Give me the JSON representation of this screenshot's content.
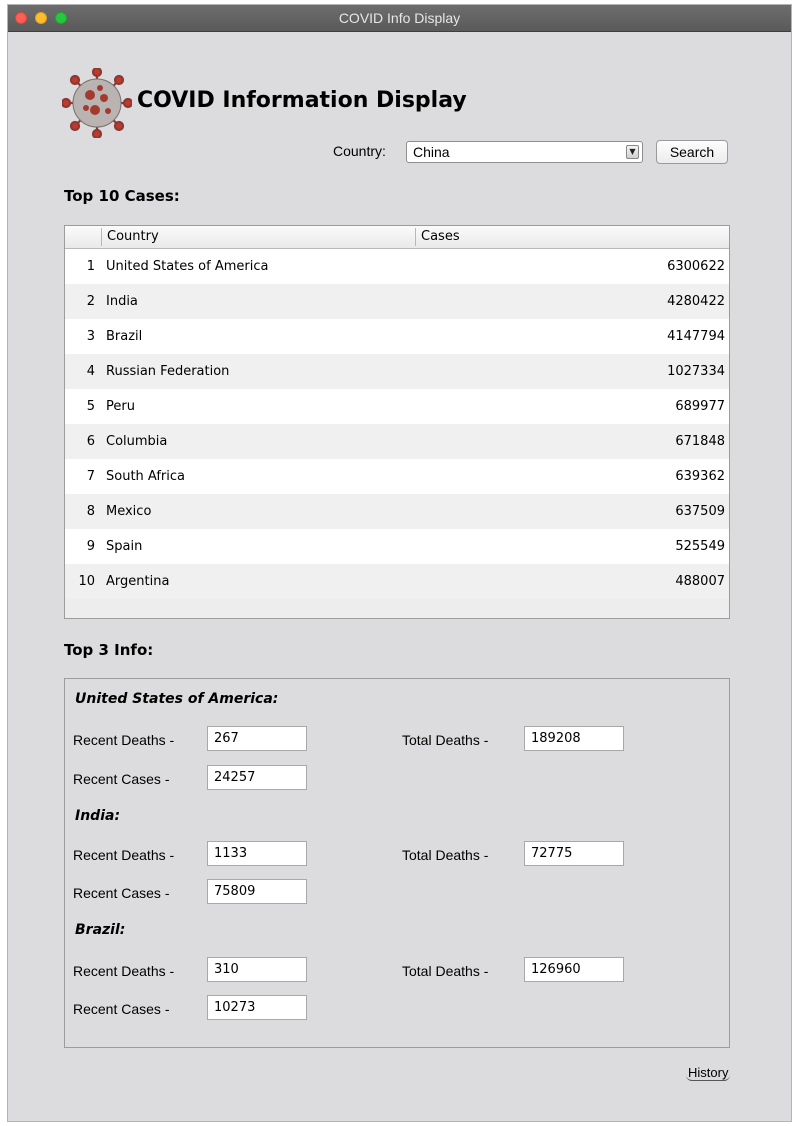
{
  "window": {
    "title": "COVID  Info Display"
  },
  "header": {
    "title": "COVID Information Display",
    "logo_icon": "virus-icon"
  },
  "search": {
    "country_label": "Country:",
    "country_value": "China",
    "search_label": "Search"
  },
  "top10": {
    "title": "Top 10 Cases:",
    "columns": [
      "",
      "Country",
      "Cases"
    ],
    "rows": [
      {
        "rank": "1",
        "country": "United States of America",
        "cases": "6300622"
      },
      {
        "rank": "2",
        "country": "India",
        "cases": "4280422"
      },
      {
        "rank": "3",
        "country": "Brazil",
        "cases": "4147794"
      },
      {
        "rank": "4",
        "country": "Russian Federation",
        "cases": "1027334"
      },
      {
        "rank": "5",
        "country": "Peru",
        "cases": "689977"
      },
      {
        "rank": "6",
        "country": "Columbia",
        "cases": "671848"
      },
      {
        "rank": "7",
        "country": "South Africa",
        "cases": "639362"
      },
      {
        "rank": "8",
        "country": "Mexico",
        "cases": "637509"
      },
      {
        "rank": "9",
        "country": "Spain",
        "cases": "525549"
      },
      {
        "rank": "10",
        "country": "Argentina",
        "cases": "488007"
      }
    ]
  },
  "top3": {
    "title": "Top 3 Info:",
    "recent_deaths_label": "Recent Deaths -",
    "recent_cases_label": "Recent Cases -",
    "total_deaths_label": "Total Deaths -",
    "countries": [
      {
        "name": "United States of America:",
        "recent_deaths": "267",
        "total_deaths": "189208",
        "recent_cases": "24257"
      },
      {
        "name": "India:",
        "recent_deaths": "1133",
        "total_deaths": "72775",
        "recent_cases": "75809"
      },
      {
        "name": "Brazil:",
        "recent_deaths": "310",
        "total_deaths": "126960",
        "recent_cases": "10273"
      }
    ]
  },
  "footer": {
    "history_label": "History"
  },
  "colors": {
    "window_bg": "#dcdcde",
    "titlebar": "#5f5f5f",
    "close": "#fd5f57",
    "minimize": "#febc2e",
    "maximize": "#27c840"
  }
}
